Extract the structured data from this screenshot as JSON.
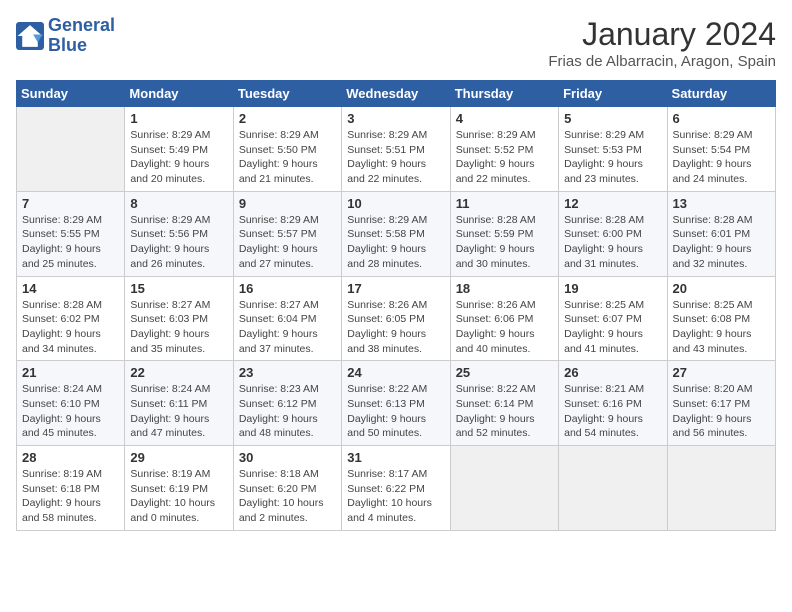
{
  "header": {
    "logo": {
      "line1": "General",
      "line2": "Blue"
    },
    "title": "January 2024",
    "location": "Frias de Albarracin, Aragon, Spain"
  },
  "days_of_week": [
    "Sunday",
    "Monday",
    "Tuesday",
    "Wednesday",
    "Thursday",
    "Friday",
    "Saturday"
  ],
  "weeks": [
    [
      {
        "day": "",
        "info": ""
      },
      {
        "day": "1",
        "info": "Sunrise: 8:29 AM\nSunset: 5:49 PM\nDaylight: 9 hours\nand 20 minutes."
      },
      {
        "day": "2",
        "info": "Sunrise: 8:29 AM\nSunset: 5:50 PM\nDaylight: 9 hours\nand 21 minutes."
      },
      {
        "day": "3",
        "info": "Sunrise: 8:29 AM\nSunset: 5:51 PM\nDaylight: 9 hours\nand 22 minutes."
      },
      {
        "day": "4",
        "info": "Sunrise: 8:29 AM\nSunset: 5:52 PM\nDaylight: 9 hours\nand 22 minutes."
      },
      {
        "day": "5",
        "info": "Sunrise: 8:29 AM\nSunset: 5:53 PM\nDaylight: 9 hours\nand 23 minutes."
      },
      {
        "day": "6",
        "info": "Sunrise: 8:29 AM\nSunset: 5:54 PM\nDaylight: 9 hours\nand 24 minutes."
      }
    ],
    [
      {
        "day": "7",
        "info": "Sunrise: 8:29 AM\nSunset: 5:55 PM\nDaylight: 9 hours\nand 25 minutes."
      },
      {
        "day": "8",
        "info": "Sunrise: 8:29 AM\nSunset: 5:56 PM\nDaylight: 9 hours\nand 26 minutes."
      },
      {
        "day": "9",
        "info": "Sunrise: 8:29 AM\nSunset: 5:57 PM\nDaylight: 9 hours\nand 27 minutes."
      },
      {
        "day": "10",
        "info": "Sunrise: 8:29 AM\nSunset: 5:58 PM\nDaylight: 9 hours\nand 28 minutes."
      },
      {
        "day": "11",
        "info": "Sunrise: 8:28 AM\nSunset: 5:59 PM\nDaylight: 9 hours\nand 30 minutes."
      },
      {
        "day": "12",
        "info": "Sunrise: 8:28 AM\nSunset: 6:00 PM\nDaylight: 9 hours\nand 31 minutes."
      },
      {
        "day": "13",
        "info": "Sunrise: 8:28 AM\nSunset: 6:01 PM\nDaylight: 9 hours\nand 32 minutes."
      }
    ],
    [
      {
        "day": "14",
        "info": "Sunrise: 8:28 AM\nSunset: 6:02 PM\nDaylight: 9 hours\nand 34 minutes."
      },
      {
        "day": "15",
        "info": "Sunrise: 8:27 AM\nSunset: 6:03 PM\nDaylight: 9 hours\nand 35 minutes."
      },
      {
        "day": "16",
        "info": "Sunrise: 8:27 AM\nSunset: 6:04 PM\nDaylight: 9 hours\nand 37 minutes."
      },
      {
        "day": "17",
        "info": "Sunrise: 8:26 AM\nSunset: 6:05 PM\nDaylight: 9 hours\nand 38 minutes."
      },
      {
        "day": "18",
        "info": "Sunrise: 8:26 AM\nSunset: 6:06 PM\nDaylight: 9 hours\nand 40 minutes."
      },
      {
        "day": "19",
        "info": "Sunrise: 8:25 AM\nSunset: 6:07 PM\nDaylight: 9 hours\nand 41 minutes."
      },
      {
        "day": "20",
        "info": "Sunrise: 8:25 AM\nSunset: 6:08 PM\nDaylight: 9 hours\nand 43 minutes."
      }
    ],
    [
      {
        "day": "21",
        "info": "Sunrise: 8:24 AM\nSunset: 6:10 PM\nDaylight: 9 hours\nand 45 minutes."
      },
      {
        "day": "22",
        "info": "Sunrise: 8:24 AM\nSunset: 6:11 PM\nDaylight: 9 hours\nand 47 minutes."
      },
      {
        "day": "23",
        "info": "Sunrise: 8:23 AM\nSunset: 6:12 PM\nDaylight: 9 hours\nand 48 minutes."
      },
      {
        "day": "24",
        "info": "Sunrise: 8:22 AM\nSunset: 6:13 PM\nDaylight: 9 hours\nand 50 minutes."
      },
      {
        "day": "25",
        "info": "Sunrise: 8:22 AM\nSunset: 6:14 PM\nDaylight: 9 hours\nand 52 minutes."
      },
      {
        "day": "26",
        "info": "Sunrise: 8:21 AM\nSunset: 6:16 PM\nDaylight: 9 hours\nand 54 minutes."
      },
      {
        "day": "27",
        "info": "Sunrise: 8:20 AM\nSunset: 6:17 PM\nDaylight: 9 hours\nand 56 minutes."
      }
    ],
    [
      {
        "day": "28",
        "info": "Sunrise: 8:19 AM\nSunset: 6:18 PM\nDaylight: 9 hours\nand 58 minutes."
      },
      {
        "day": "29",
        "info": "Sunrise: 8:19 AM\nSunset: 6:19 PM\nDaylight: 10 hours\nand 0 minutes."
      },
      {
        "day": "30",
        "info": "Sunrise: 8:18 AM\nSunset: 6:20 PM\nDaylight: 10 hours\nand 2 minutes."
      },
      {
        "day": "31",
        "info": "Sunrise: 8:17 AM\nSunset: 6:22 PM\nDaylight: 10 hours\nand 4 minutes."
      },
      {
        "day": "",
        "info": ""
      },
      {
        "day": "",
        "info": ""
      },
      {
        "day": "",
        "info": ""
      }
    ]
  ]
}
